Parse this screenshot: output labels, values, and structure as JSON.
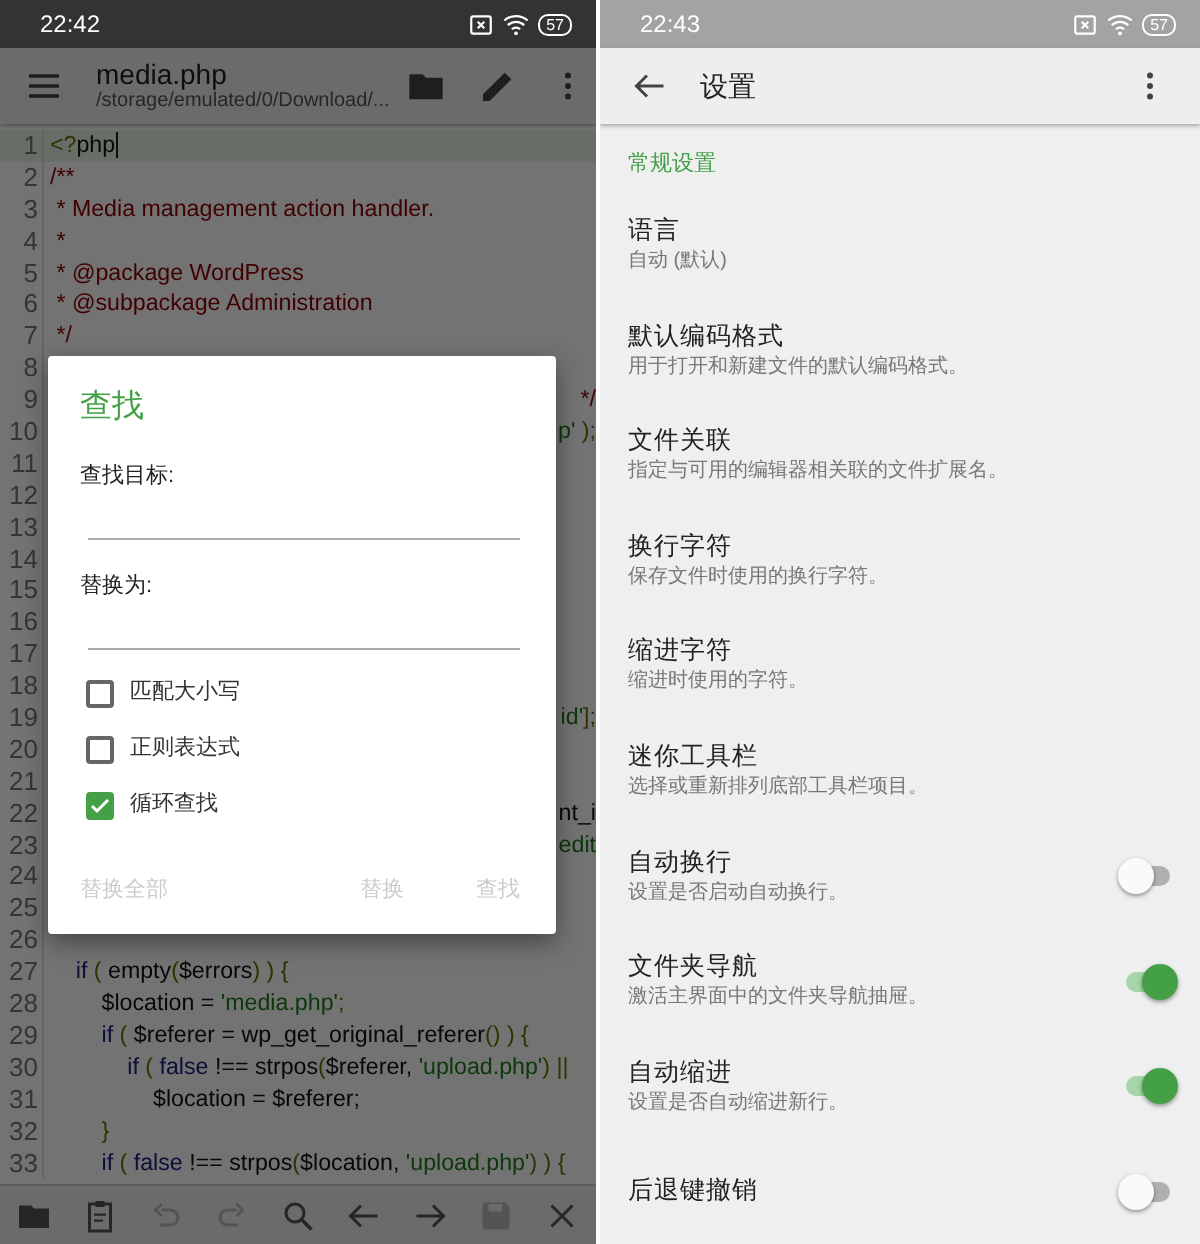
{
  "editor_screen": {
    "status_bar": {
      "time": "22:42",
      "battery": "57"
    },
    "toolbar": {
      "title": "media.php",
      "subtitle": "/storage/emulated/0/Download/..."
    },
    "code_lines": [
      {
        "number": "1",
        "current": true,
        "kind": "code",
        "segments": [
          {
            "kind": "punct",
            "text": "<?"
          },
          {
            "kind": "plain",
            "text": "php"
          }
        ]
      },
      {
        "number": "2",
        "current": false,
        "kind": "code",
        "segments": [
          {
            "kind": "comment",
            "text": "/**"
          }
        ]
      },
      {
        "number": "3",
        "current": false,
        "kind": "code",
        "segments": [
          {
            "kind": "comment",
            "text": " * Media management action handler."
          }
        ]
      },
      {
        "number": "4",
        "current": false,
        "kind": "code",
        "segments": [
          {
            "kind": "comment",
            "text": " *"
          }
        ]
      },
      {
        "number": "5",
        "current": false,
        "kind": "code",
        "segments": [
          {
            "kind": "comment",
            "text": " * @package WordPress"
          }
        ]
      },
      {
        "number": "6",
        "current": false,
        "kind": "code",
        "segments": [
          {
            "kind": "comment",
            "text": " * @subpackage Administration"
          }
        ]
      },
      {
        "number": "7",
        "current": false,
        "kind": "code",
        "segments": [
          {
            "kind": "comment",
            "text": " */"
          }
        ]
      },
      {
        "number": "8",
        "current": false
      },
      {
        "number": "9",
        "current": false,
        "kind": "fragment",
        "segments": [
          {
            "kind": "comment",
            "text": "*/"
          }
        ]
      },
      {
        "number": "10",
        "current": false,
        "kind": "fragment",
        "segments": [
          {
            "kind": "string",
            "text": "p'"
          },
          {
            "kind": "punct",
            "text": " );"
          }
        ]
      },
      {
        "number": "11",
        "current": false
      },
      {
        "number": "12",
        "current": false
      },
      {
        "number": "13",
        "current": false
      },
      {
        "number": "14",
        "current": false
      },
      {
        "number": "15",
        "current": false
      },
      {
        "number": "16",
        "current": false
      },
      {
        "number": "17",
        "current": false
      },
      {
        "number": "18",
        "current": false
      },
      {
        "number": "19",
        "current": false,
        "kind": "fragment",
        "segments": [
          {
            "kind": "string",
            "text": "id'"
          },
          {
            "kind": "punct",
            "text": "];"
          }
        ]
      },
      {
        "number": "20",
        "current": false
      },
      {
        "number": "21",
        "current": false
      },
      {
        "number": "22",
        "current": false,
        "kind": "fragment",
        "segments": [
          {
            "kind": "plain",
            "text": "nt_i"
          }
        ]
      },
      {
        "number": "23",
        "current": false,
        "kind": "fragment",
        "segments": [
          {
            "kind": "string",
            "text": "edit"
          }
        ]
      },
      {
        "number": "24",
        "current": false
      },
      {
        "number": "25",
        "current": false
      },
      {
        "number": "26",
        "current": false
      },
      {
        "number": "27",
        "current": false,
        "kind": "code",
        "segments": [
          {
            "kind": "keyword",
            "text": "    if"
          },
          {
            "kind": "punct",
            "text": " ( "
          },
          {
            "kind": "plain",
            "text": "empty"
          },
          {
            "kind": "punct",
            "text": "("
          },
          {
            "kind": "plain",
            "text": "$errors"
          },
          {
            "kind": "punct",
            "text": ") ) {"
          }
        ]
      },
      {
        "number": "28",
        "current": false,
        "kind": "code",
        "segments": [
          {
            "kind": "plain",
            "text": "        $location = "
          },
          {
            "kind": "string",
            "text": "'media.php'"
          },
          {
            "kind": "punct",
            "text": ";"
          }
        ]
      },
      {
        "number": "29",
        "current": false,
        "kind": "code",
        "segments": [
          {
            "kind": "keyword",
            "text": "        if"
          },
          {
            "kind": "punct",
            "text": " ( "
          },
          {
            "kind": "plain",
            "text": "$referer = wp_get_original_referer"
          },
          {
            "kind": "punct",
            "text": "() ) {"
          }
        ]
      },
      {
        "number": "30",
        "current": false,
        "kind": "code",
        "segments": [
          {
            "kind": "keyword",
            "text": "            if"
          },
          {
            "kind": "punct",
            "text": " ( "
          },
          {
            "kind": "keyword",
            "text": "false"
          },
          {
            "kind": "plain",
            "text": " !== strpos"
          },
          {
            "kind": "punct",
            "text": "("
          },
          {
            "kind": "plain",
            "text": "$referer, "
          },
          {
            "kind": "string",
            "text": "'upload.php'"
          },
          {
            "kind": "punct",
            "text": ") ||"
          }
        ]
      },
      {
        "number": "31",
        "current": false,
        "kind": "code",
        "segments": [
          {
            "kind": "plain",
            "text": "                $location = $referer;"
          }
        ]
      },
      {
        "number": "32",
        "current": false,
        "kind": "code",
        "segments": [
          {
            "kind": "punct",
            "text": "        }"
          }
        ]
      },
      {
        "number": "33",
        "current": false,
        "kind": "code",
        "segments": [
          {
            "kind": "keyword",
            "text": "        if"
          },
          {
            "kind": "punct",
            "text": " ( "
          },
          {
            "kind": "keyword",
            "text": "false"
          },
          {
            "kind": "plain",
            "text": " !== strpos"
          },
          {
            "kind": "punct",
            "text": "("
          },
          {
            "kind": "plain",
            "text": "$location, "
          },
          {
            "kind": "string",
            "text": "'upload.php'"
          },
          {
            "kind": "punct",
            "text": ") ) {"
          }
        ]
      }
    ],
    "find_dialog": {
      "title": "查找",
      "find_label": "查找目标:",
      "replace_label": "替换为:",
      "options": [
        {
          "label": "匹配大小写",
          "checked": false
        },
        {
          "label": "正则表达式",
          "checked": false
        },
        {
          "label": "循环查找",
          "checked": true
        }
      ],
      "buttons": [
        {
          "label": "替换全部",
          "disabled": true
        },
        {
          "label": "替换",
          "disabled": true
        },
        {
          "label": "查找",
          "disabled": true
        }
      ]
    },
    "bottom_bar": [
      {
        "kind": "folder",
        "disabled": false
      },
      {
        "kind": "clipboard",
        "disabled": false
      },
      {
        "kind": "undo",
        "disabled": true
      },
      {
        "kind": "redo",
        "disabled": true
      },
      {
        "kind": "search",
        "disabled": false
      },
      {
        "kind": "back",
        "disabled": false
      },
      {
        "kind": "forward",
        "disabled": false
      },
      {
        "kind": "save",
        "disabled": true
      },
      {
        "kind": "close",
        "disabled": false
      }
    ]
  },
  "settings_screen": {
    "status_bar": {
      "time": "22:43",
      "battery": "57"
    },
    "toolbar": {
      "title": "设置"
    },
    "section": "常规设置",
    "items": [
      {
        "kind": "plain",
        "title": "语言",
        "subtitle": "自动 (默认)"
      },
      {
        "kind": "plain",
        "title": "默认编码格式",
        "subtitle": "用于打开和新建文件的默认编码格式。"
      },
      {
        "kind": "plain",
        "title": "文件关联",
        "subtitle": "指定与可用的编辑器相关联的文件扩展名。"
      },
      {
        "kind": "plain",
        "title": "换行字符",
        "subtitle": "保存文件时使用的换行字符。"
      },
      {
        "kind": "plain",
        "title": "缩进字符",
        "subtitle": "缩进时使用的字符。"
      },
      {
        "kind": "plain",
        "title": "迷你工具栏",
        "subtitle": "选择或重新排列底部工具栏项目。"
      },
      {
        "kind": "switch",
        "title": "自动换行",
        "subtitle": "设置是否启动自动换行。",
        "on": false
      },
      {
        "kind": "switch",
        "title": "文件夹导航",
        "subtitle": "激活主界面中的文件夹导航抽屉。",
        "on": true
      },
      {
        "kind": "switch",
        "title": "自动缩进",
        "subtitle": "设置是否自动缩进新行。",
        "on": true
      },
      {
        "kind": "switch",
        "title": "后退键撤销",
        "on": false
      }
    ]
  }
}
